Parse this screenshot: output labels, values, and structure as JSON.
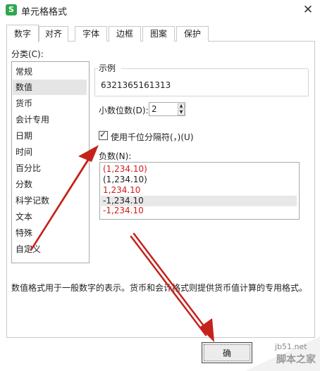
{
  "window": {
    "title": "单元格格式",
    "app_icon_letter": "S"
  },
  "tabs": [
    {
      "label": "数字",
      "active": true
    },
    {
      "label": "对齐",
      "active": false
    },
    {
      "label": "字体",
      "active": false
    },
    {
      "label": "边框",
      "active": false
    },
    {
      "label": "图案",
      "active": false
    },
    {
      "label": "保护",
      "active": false
    }
  ],
  "category": {
    "label": "分类(C):",
    "items": [
      "常规",
      "数值",
      "货币",
      "会计专用",
      "日期",
      "时间",
      "百分比",
      "分数",
      "科学记数",
      "文本",
      "特殊",
      "自定义"
    ],
    "selected": "数值"
  },
  "sample": {
    "label": "示例",
    "value": "6321365161313"
  },
  "decimals": {
    "label": "小数位数(D):",
    "value": "2"
  },
  "thousands": {
    "label": "使用千位分隔符(，)(U)",
    "checked": true
  },
  "negative": {
    "label": "负数(N):",
    "items": [
      {
        "text": "(1,234.10)",
        "color": "#d11c1c"
      },
      {
        "text": "(1,234.10)",
        "color": "#222222"
      },
      {
        "text": "1,234.10",
        "color": "#d11c1c"
      },
      {
        "text": "-1,234.10",
        "color": "#222222",
        "selected": true
      },
      {
        "text": "-1,234.10",
        "color": "#d11c1c"
      }
    ]
  },
  "description": "数值格式用于一般数字的表示。货币和会计格式则提供货币值计算的专用格式。",
  "buttons": {
    "ok": "确"
  },
  "watermark": {
    "url": "jb51.net",
    "main": "脚本之家"
  },
  "colors": {
    "arrow": "#c4221b",
    "app_icon": "#2fa84f",
    "accent_red": "#d11c1c"
  }
}
